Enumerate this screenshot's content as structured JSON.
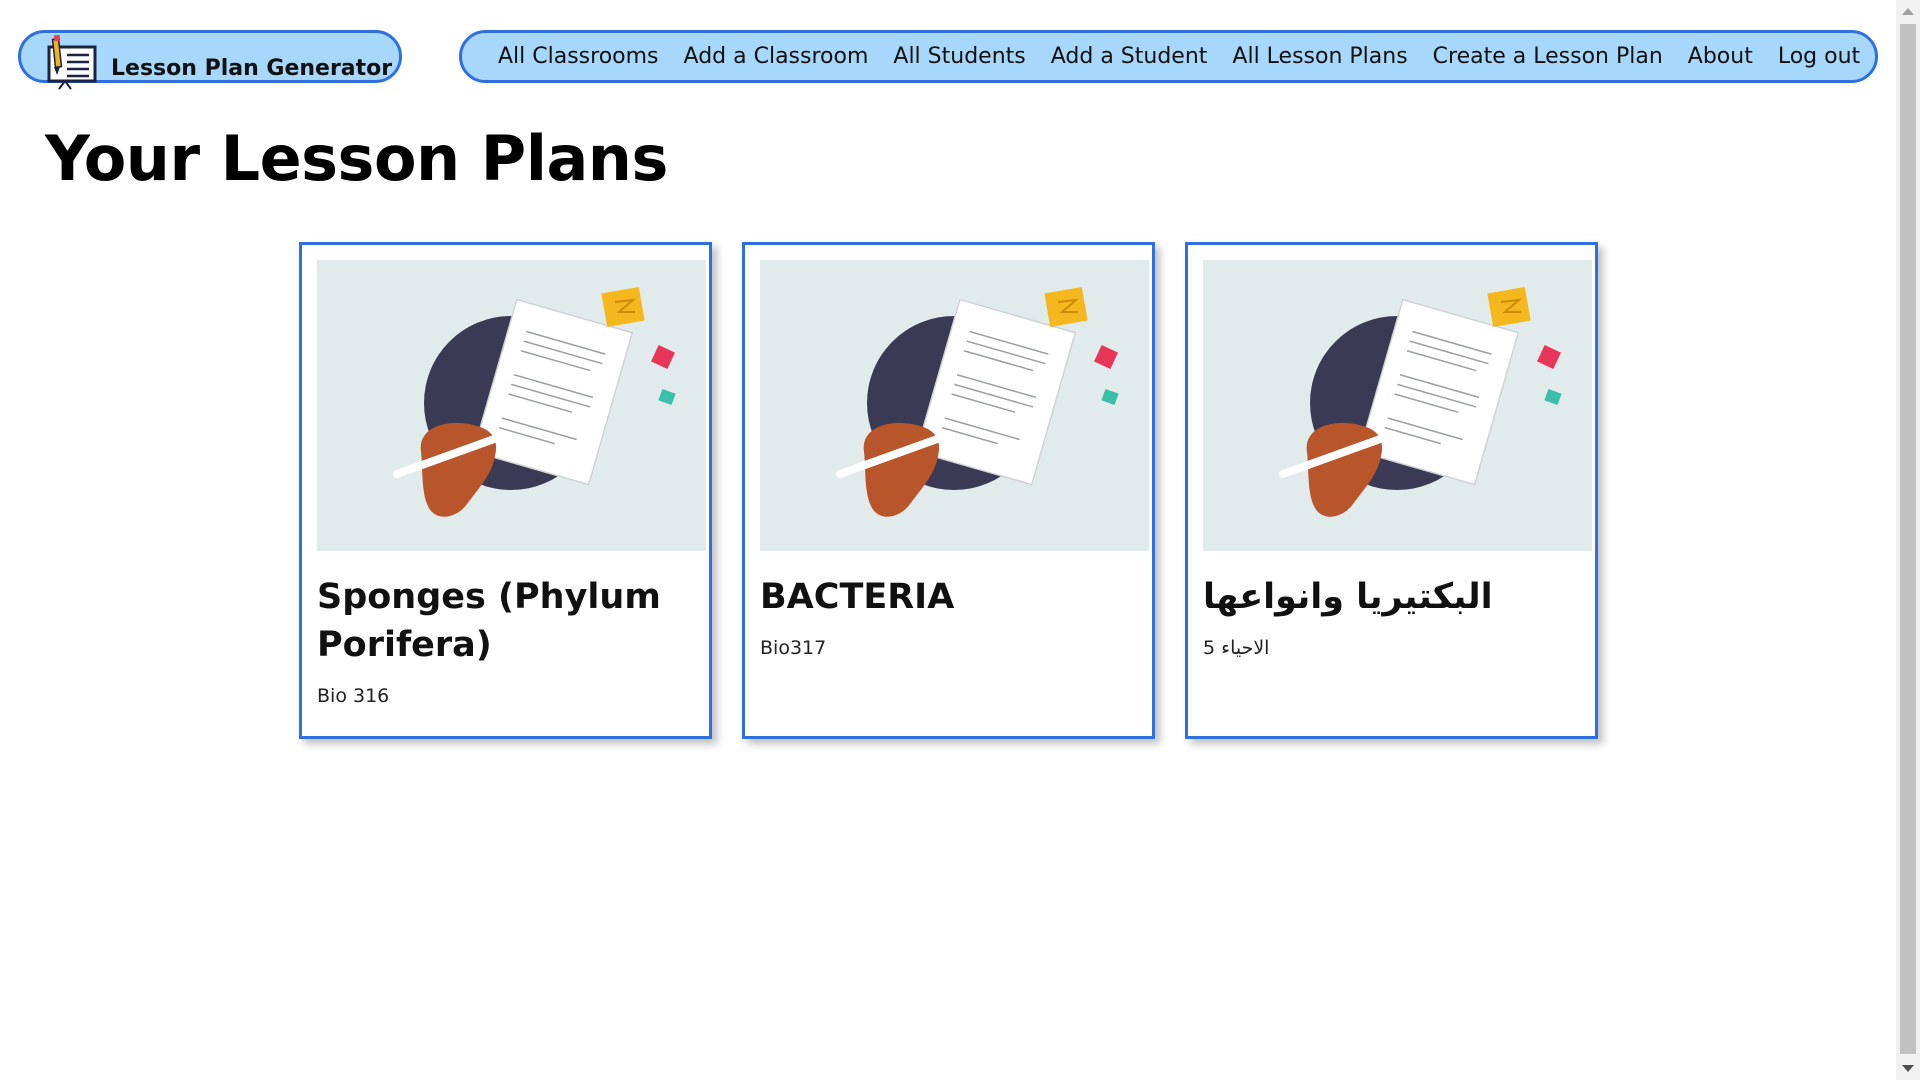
{
  "brand": {
    "title": "Lesson Plan Generator",
    "icon": "lesson-board-icon"
  },
  "nav": {
    "items": [
      {
        "label": "All Classrooms"
      },
      {
        "label": "Add a Classroom"
      },
      {
        "label": "All Students"
      },
      {
        "label": "Add a Student"
      },
      {
        "label": "All Lesson Plans"
      },
      {
        "label": "Create a Lesson Plan"
      },
      {
        "label": "About"
      },
      {
        "label": "Log out"
      }
    ]
  },
  "page": {
    "title": "Your Lesson Plans"
  },
  "lesson_plans": [
    {
      "title": "Sponges (Phylum Porifera)",
      "classroom": "Bio 316",
      "image": "lesson-plan-illustration"
    },
    {
      "title": "BACTERIA",
      "classroom": "Bio317",
      "image": "lesson-plan-illustration"
    },
    {
      "title": "البكتيريا وانواعها",
      "classroom": "الاحياء 5",
      "image": "lesson-plan-illustration"
    }
  ],
  "colors": {
    "nav_bg": "#a7d8fb",
    "accent_border": "#2f6fe0",
    "card_image_bg": "#e2ebeb"
  }
}
